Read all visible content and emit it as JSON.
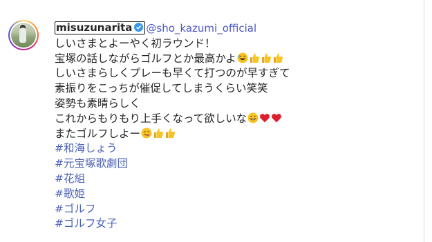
{
  "post": {
    "username": "misuzunarita",
    "mention": "@sho_kazumi_official",
    "lines": [
      "しいさまとよーやく初ラウンド！",
      "宝塚の話しながらゴルフとか最高かよ",
      "しいさまらしくプレーも早くて打つのが早すぎて",
      "素振りをこっちが催促してしまうくらい笑笑",
      "姿勢も素晴らしく",
      "これからもりもり上手くなって欲しいな",
      "またゴルフしよー"
    ],
    "hashtags": [
      "#和海しょう",
      "#元宝塚歌劇団",
      "#花組",
      "#歌姫",
      "#ゴルフ",
      "#ゴルフ女子"
    ]
  },
  "icons": {
    "verified": "verified-badge-icon",
    "laugh": "rolling-laughing-emoji",
    "thumbs": "thumbs-up-emoji",
    "grin": "grinning-emoji",
    "heart": "red-heart-emoji",
    "yum": "savoring-food-emoji"
  },
  "colors": {
    "hashtag": "#4c62b6",
    "mention": "#4a57c4",
    "verified": "#3897f0",
    "text": "#262626"
  }
}
